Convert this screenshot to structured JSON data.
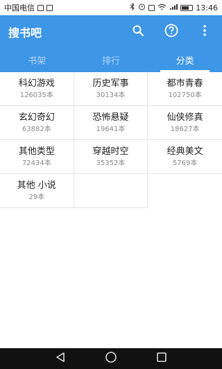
{
  "status_bar": {
    "carrier": "中国电信",
    "time": "13:46"
  },
  "appbar": {
    "title": "搜书吧",
    "icons": [
      "search-icon",
      "help-icon",
      "more-vert-icon"
    ]
  },
  "tabs": [
    {
      "label": "书架",
      "active": false
    },
    {
      "label": "排行",
      "active": false
    },
    {
      "label": "分类",
      "active": true
    }
  ],
  "categories": [
    {
      "name": "科幻游戏",
      "count": "126035本"
    },
    {
      "name": "历史军事",
      "count": "30134本"
    },
    {
      "name": "都市青春",
      "count": "102750本"
    },
    {
      "name": "玄幻奇幻",
      "count": "63882本"
    },
    {
      "name": "恐怖悬疑",
      "count": "19641本"
    },
    {
      "name": "仙侠修真",
      "count": "18627本"
    },
    {
      "name": "其他类型",
      "count": "72434本"
    },
    {
      "name": "穿越时空",
      "count": "35352本"
    },
    {
      "name": "经典美文",
      "count": "5769本"
    },
    {
      "name": "其他 小说",
      "count": "29本"
    }
  ],
  "colors": {
    "primary": "#3d96e6",
    "tab_inactive": "#b3d5f6"
  }
}
